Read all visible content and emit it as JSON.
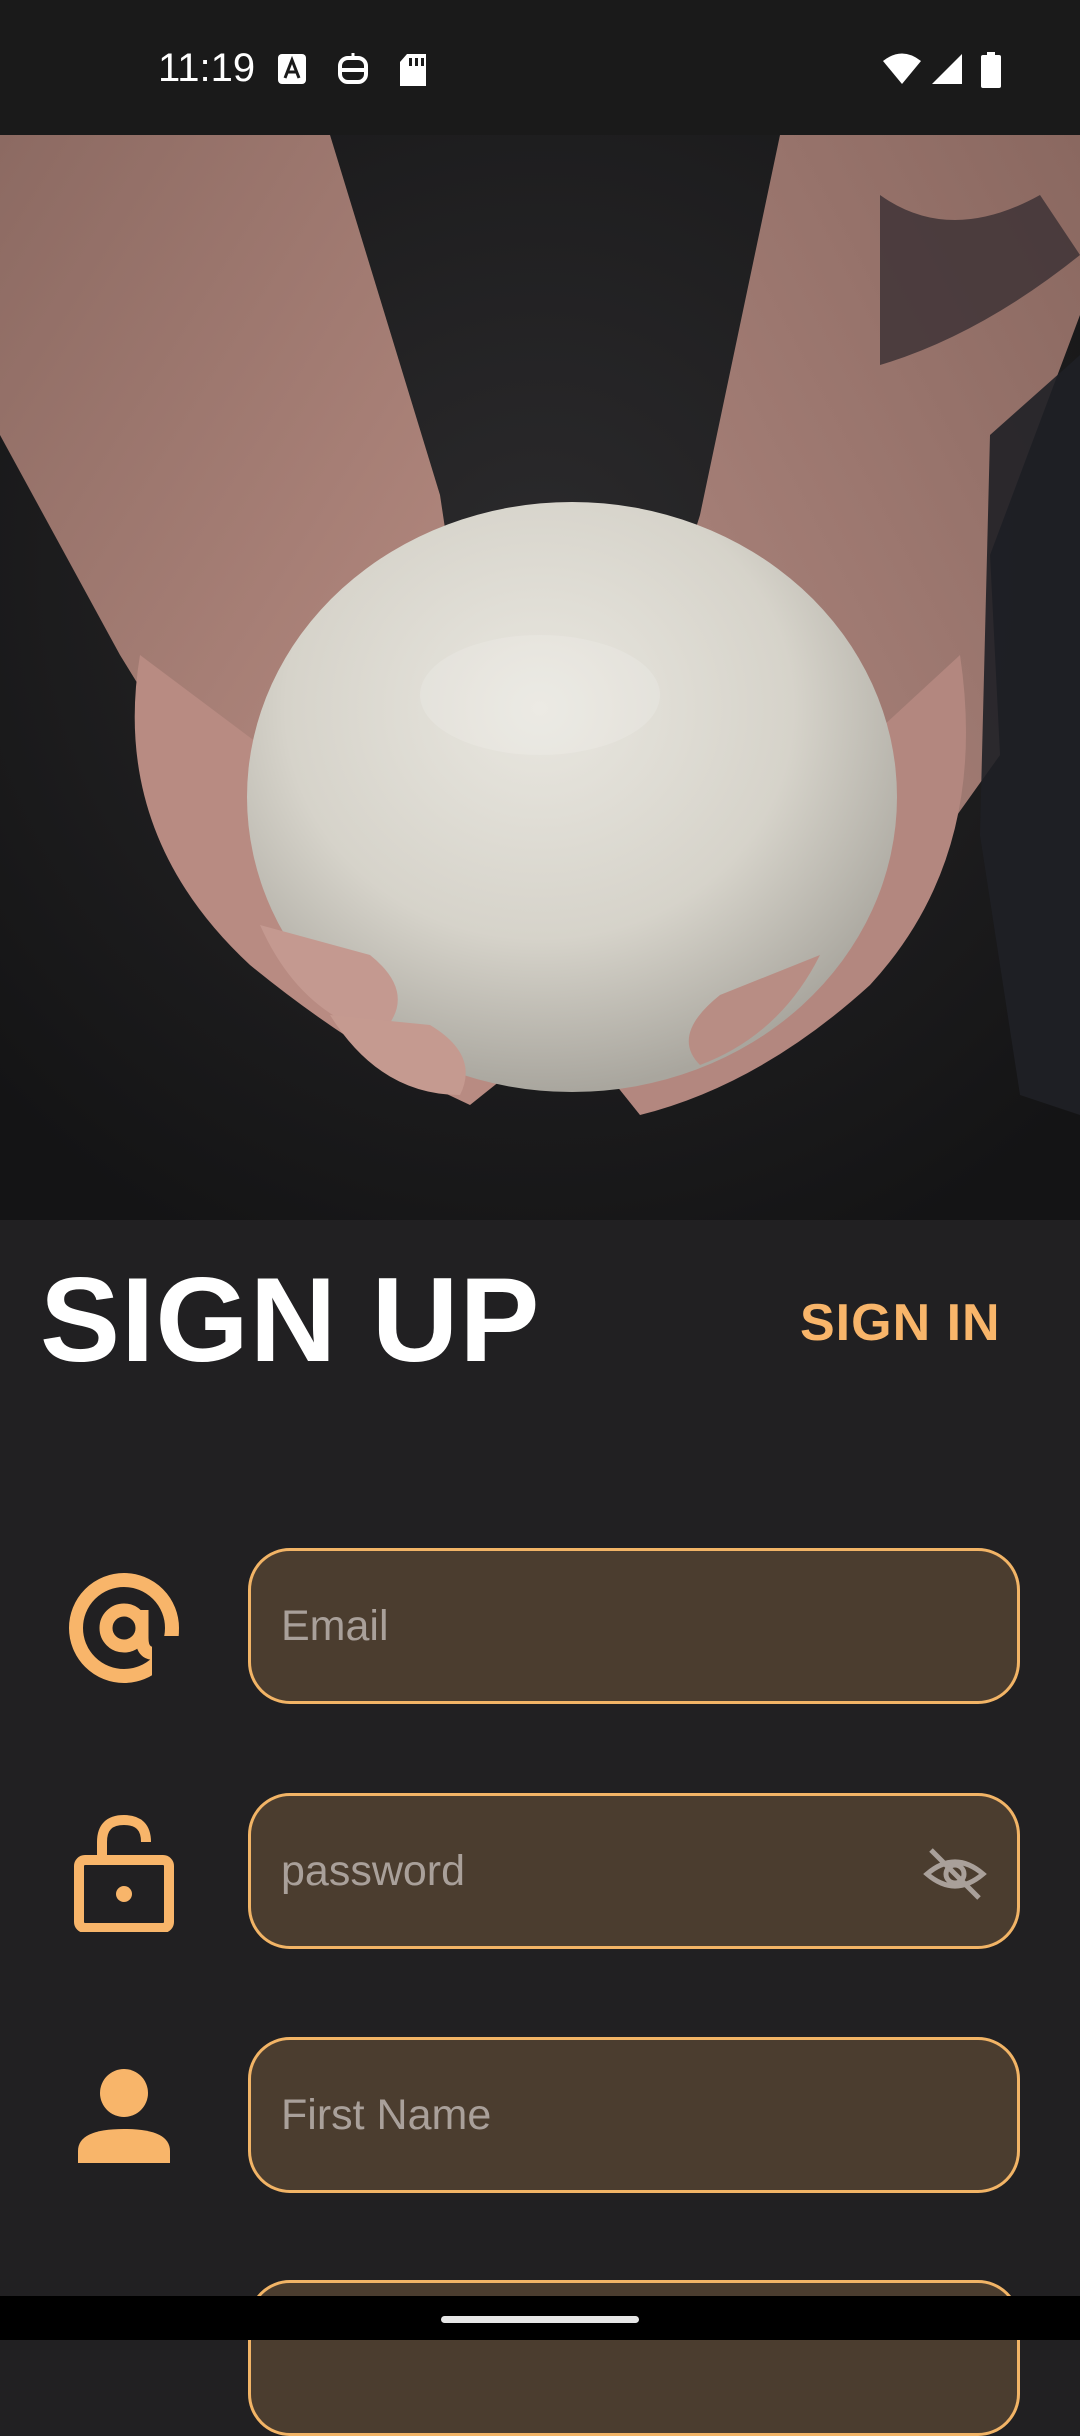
{
  "status_bar": {
    "time": "11:19",
    "icons": [
      "font-a-icon",
      "robot-icon",
      "sd-card-icon",
      "wifi-icon",
      "signal-icon",
      "battery-icon"
    ]
  },
  "hero": {
    "image_subject": "hands holding ball of dough"
  },
  "header": {
    "title": "SIGN UP",
    "signin_label": "SIGN IN"
  },
  "form": {
    "email": {
      "placeholder": "Email",
      "value": "",
      "icon": "at-icon"
    },
    "password": {
      "placeholder": "password",
      "value": "",
      "icon": "lock-icon",
      "toggle_icon": "eye-off-icon"
    },
    "first_name": {
      "placeholder": "First Name",
      "value": "",
      "icon": "person-icon"
    }
  },
  "colors": {
    "accent": "#f8b56a",
    "field_bg": "#4b3d2f",
    "background": "#212022"
  }
}
